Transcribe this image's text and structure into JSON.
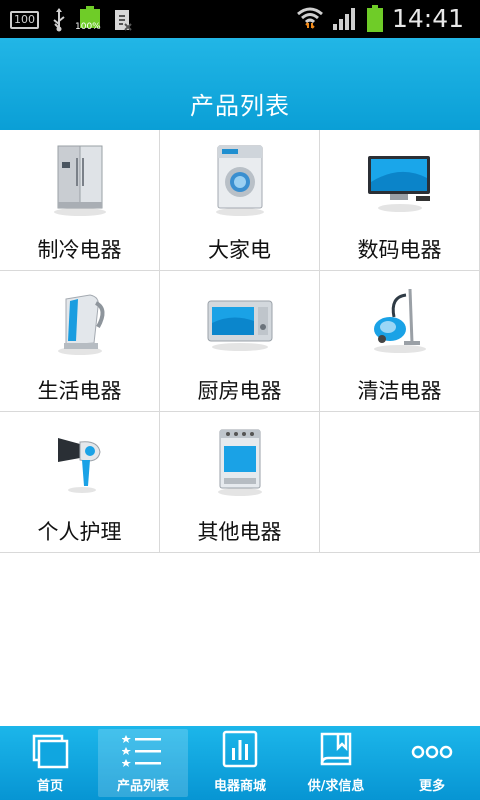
{
  "status_bar": {
    "left_box_text": "100",
    "battery_small_text": "100%",
    "time": "14:41"
  },
  "header": {
    "title": "产品列表"
  },
  "categories": [
    {
      "label": "制冷电器",
      "icon": "refrigerator-icon"
    },
    {
      "label": "大家电",
      "icon": "washing-machine-icon"
    },
    {
      "label": "数码电器",
      "icon": "television-icon"
    },
    {
      "label": "生活电器",
      "icon": "kettle-icon"
    },
    {
      "label": "厨房电器",
      "icon": "microwave-icon"
    },
    {
      "label": "清洁电器",
      "icon": "vacuum-cleaner-icon"
    },
    {
      "label": "个人护理",
      "icon": "hair-dryer-icon"
    },
    {
      "label": "其他电器",
      "icon": "oven-icon"
    }
  ],
  "bottom_nav": {
    "tabs": [
      {
        "label": "首页",
        "icon": "home-pages-icon"
      },
      {
        "label": "产品列表",
        "icon": "list-icon"
      },
      {
        "label": "电器商城",
        "icon": "chart-icon"
      },
      {
        "label": "供/求信息",
        "icon": "book-icon"
      },
      {
        "label": "更多",
        "icon": "more-dots-icon"
      }
    ],
    "active": "产品列表"
  },
  "colors": {
    "header_top": "#22b6e6",
    "header_bottom": "#0a9fd6",
    "nav_top": "#1cb6ea",
    "nav_bottom": "#0795d3",
    "grid_line": "#d9d9d9"
  }
}
